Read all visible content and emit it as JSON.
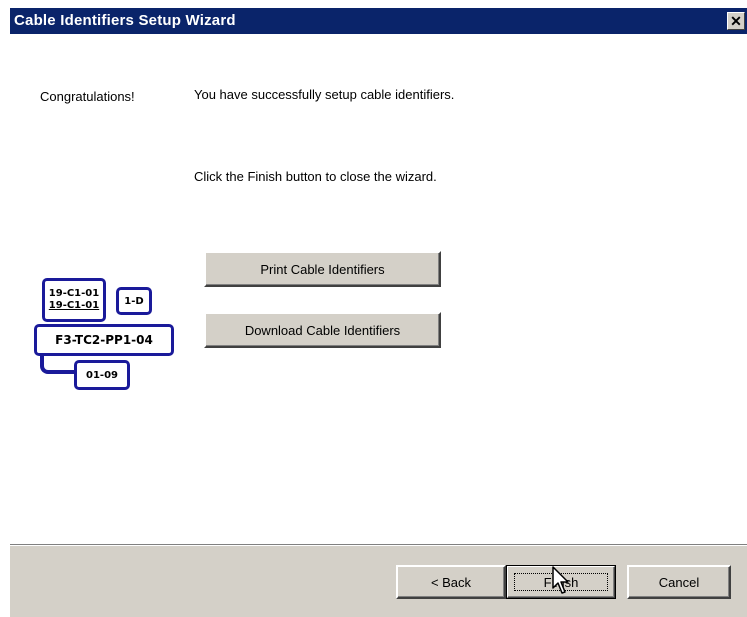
{
  "window": {
    "title": "Cable Identifiers Setup Wizard",
    "close_label": "✕"
  },
  "main": {
    "heading": "Congratulations!",
    "success_message": "You have successfully setup cable identifiers.",
    "finish_message": "Click the Finish button to close the wizard.",
    "print_button_label": "Print Cable Identifiers",
    "download_button_label": "Download Cable Identifiers"
  },
  "cable_labels": {
    "stack_line1": "19-C1-01",
    "stack_line2": "19-C1-01",
    "small_tag": "1-D",
    "main_tag": "F3-TC2-PP1-04",
    "bottom_tag": "01-09"
  },
  "footer": {
    "back_label": "< Back",
    "finish_label": "Finish",
    "cancel_label": "Cancel"
  },
  "colors": {
    "titlebar": "#0a246a",
    "button_face": "#d4d0c8",
    "label_border": "#1a1a9a"
  }
}
